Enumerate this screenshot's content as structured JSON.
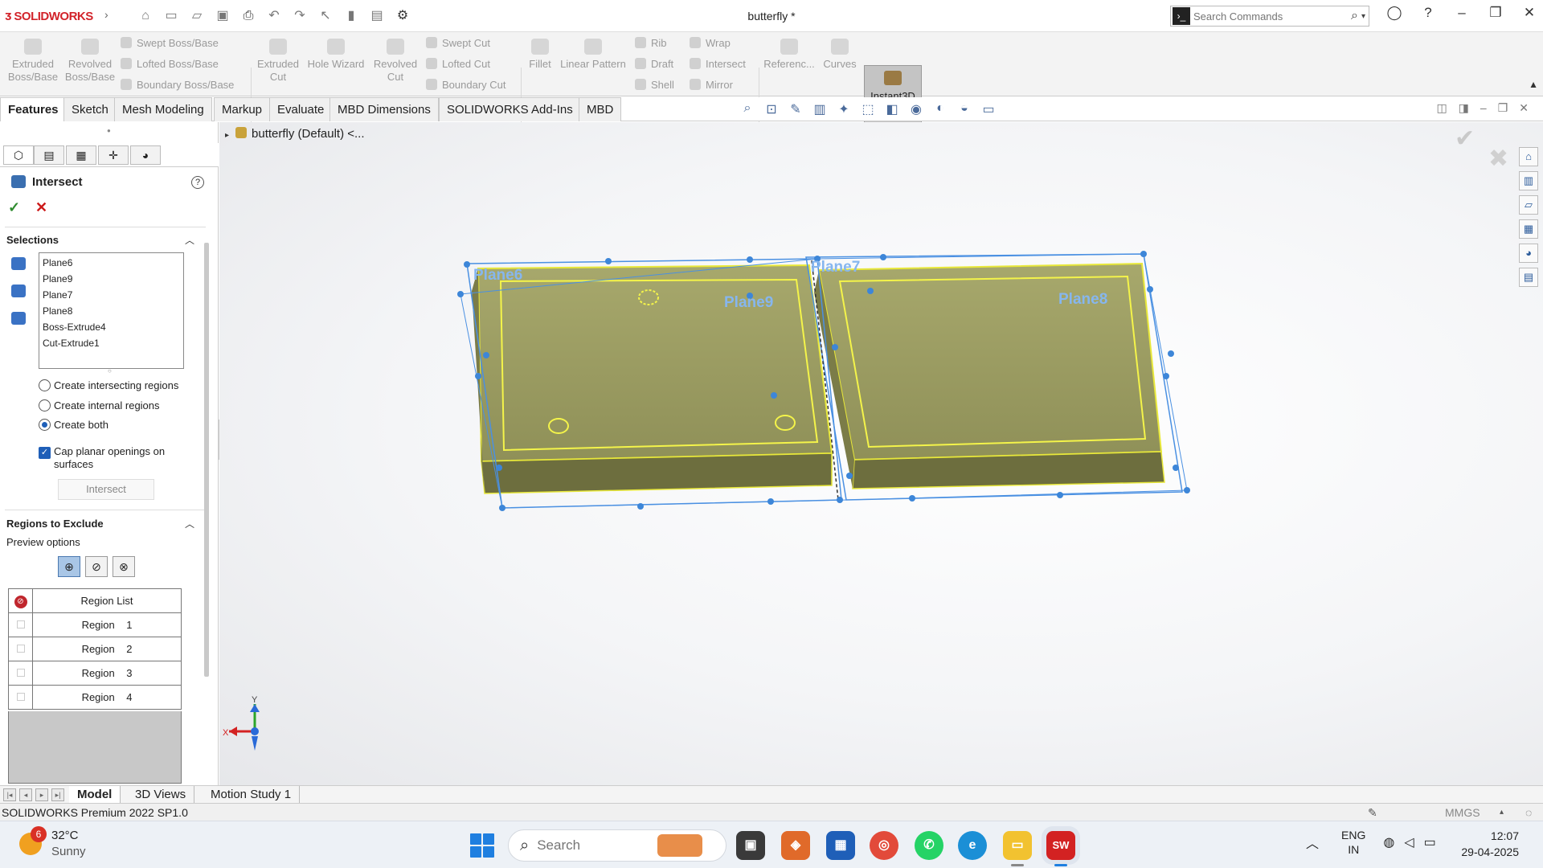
{
  "app": {
    "logo_text": "SOLIDWORKS",
    "doc_title": "butterfly *"
  },
  "quick_access": [
    "home-icon",
    "new-icon",
    "open-icon",
    "save-icon",
    "print-icon",
    "undo-icon",
    "redo-icon",
    "select-icon",
    "rebuild-icon",
    "file-props-icon",
    "options-icon"
  ],
  "search": {
    "placeholder": "Search Commands"
  },
  "ribbon": {
    "extruded_boss": "Extruded Boss/Base",
    "revolved_boss": "Revolved Boss/Base",
    "swept_boss": "Swept Boss/Base",
    "lofted_boss": "Lofted Boss/Base",
    "boundary_boss": "Boundary Boss/Base",
    "extruded_cut": "Extruded Cut",
    "hole_wizard": "Hole Wizard",
    "revolved_cut": "Revolved Cut",
    "swept_cut": "Swept Cut",
    "lofted_cut": "Lofted Cut",
    "boundary_cut": "Boundary Cut",
    "fillet": "Fillet",
    "linear_pattern": "Linear Pattern",
    "rib": "Rib",
    "draft": "Draft",
    "shell": "Shell",
    "wrap": "Wrap",
    "intersect": "Intersect",
    "mirror": "Mirror",
    "reference": "Referenc...",
    "curves": "Curves",
    "instant3d": "Instant3D"
  },
  "tabs": [
    "Features",
    "Sketch",
    "Mesh Modeling",
    "Markup",
    "Evaluate",
    "MBD Dimensions",
    "SOLIDWORKS Add-Ins",
    "MBD"
  ],
  "property_manager": {
    "title": "Intersect",
    "selections_header": "Selections",
    "selections": [
      "Plane6",
      "Plane9",
      "Plane7",
      "Plane8",
      "Boss-Extrude4",
      "Cut-Extrude1"
    ],
    "options": [
      "Create intersecting regions",
      "Create internal regions",
      "Create both"
    ],
    "selected_option": "Create both",
    "cap_label": "Cap planar openings on surfaces",
    "cap_checked": true,
    "intersect_button": "Intersect",
    "regions_header": "Regions to Exclude",
    "preview_label": "Preview options",
    "region_list_header": "Region List",
    "regions": [
      "Region    1",
      "Region    2",
      "Region    3",
      "Region    4"
    ]
  },
  "feature_tree": {
    "root": "butterfly (Default) <..."
  },
  "model": {
    "planes": [
      "Plane6",
      "Plane7",
      "Plane9",
      "Plane8"
    ],
    "colors": {
      "body_top": "#9a9b62",
      "body_side": "#6f7040",
      "edge": "#f0f040",
      "plane": "#4a90e2"
    }
  },
  "triad": {
    "x": "X",
    "y": "Y"
  },
  "bottom_tabs": [
    "Model",
    "3D Views",
    "Motion Study 1"
  ],
  "status": {
    "text": "SOLIDWORKS Premium 2022 SP1.0",
    "units": "MMGS"
  },
  "taskbar": {
    "temp": "32°C",
    "weather": "Sunny",
    "weather_badge": "6",
    "search_label": "Search",
    "lang_1": "ENG",
    "lang_2": "IN",
    "time": "12:07",
    "date": "29-04-2025",
    "sw_label": "SW"
  }
}
